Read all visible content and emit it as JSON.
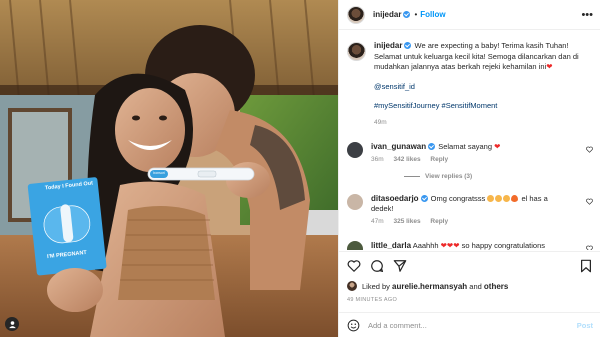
{
  "post": {
    "username": "inijedar",
    "follow_label": "Follow",
    "more_label": "•••"
  },
  "photo_card": {
    "line1": "Today I Found Out",
    "line2": "I'M PREGNANT",
    "test_label": "bonsori"
  },
  "caption": {
    "username": "inijedar",
    "text": "We are expecting a baby! Terima kasih Tuhan! Selamat untuk keluarga kecil kita! Semoga dilancarkan dan di mudahkan jalannya atas berkah rejeki kehamilan ini",
    "mention": "@sensitif_id",
    "hashtags": "#mySensitifJourney #SensitifMoment",
    "time": "49m"
  },
  "comments": [
    {
      "username": "ivan_gunawan",
      "text": "Selamat sayang",
      "time": "36m",
      "likes": "342 likes",
      "reply": "Reply",
      "avatar_color": "#3c3f44",
      "verified": true
    },
    {
      "username": "ditasoedarjo",
      "text": "Omg congratsss",
      "text_after": "el has a dedek!",
      "time": "47m",
      "likes": "325 likes",
      "reply": "Reply",
      "avatar_color": "#c9b6a6",
      "verified": true
    },
    {
      "username": "little_darla",
      "text": "Aaahhh",
      "text_after": "so happy congratulations",
      "time": "",
      "likes": "",
      "reply": "",
      "avatar_color": "#4c5a3e",
      "verified": false
    }
  ],
  "view_replies": "View replies (3)",
  "likes": {
    "prefix": "Liked by",
    "user": "aurelie.hermansyah",
    "and": "and",
    "others": "others"
  },
  "timestamp": "49 MINUTES AGO",
  "add_comment": {
    "placeholder": "Add a comment...",
    "post_label": "Post"
  },
  "colors": {
    "link": "#00376b",
    "follow": "#0095f6",
    "muted": "#8e8e8e",
    "heart": "#ed2a2a"
  }
}
